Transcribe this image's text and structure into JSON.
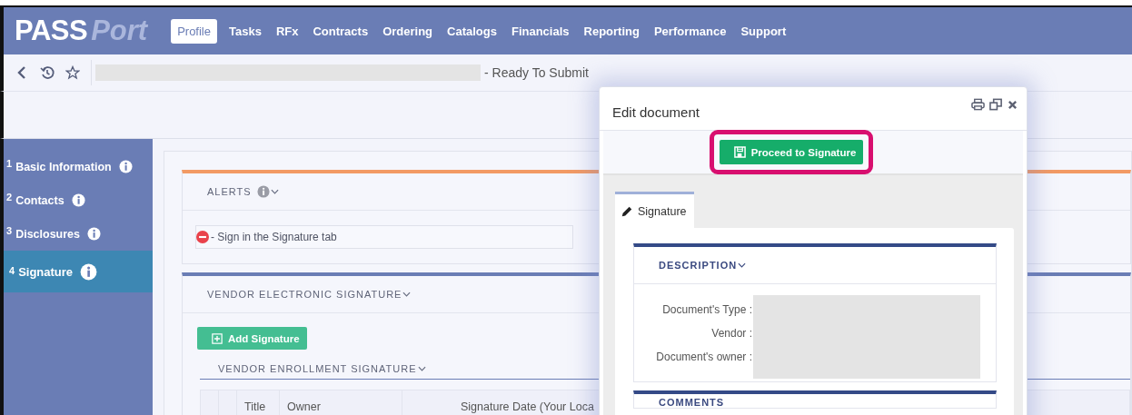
{
  "brand": {
    "bold": "PASS",
    "light": "Port"
  },
  "nav": [
    {
      "label": "Profile",
      "selected": true
    },
    {
      "label": "Tasks",
      "selected": false
    },
    {
      "label": "RFx",
      "selected": false
    },
    {
      "label": "Contracts",
      "selected": false
    },
    {
      "label": "Ordering",
      "selected": false
    },
    {
      "label": "Catalogs",
      "selected": false
    },
    {
      "label": "Financials",
      "selected": false
    },
    {
      "label": "Reporting",
      "selected": false
    },
    {
      "label": "Performance",
      "selected": false
    },
    {
      "label": "Support",
      "selected": false
    }
  ],
  "toolbar": {
    "status": "- Ready To Submit"
  },
  "steps": [
    {
      "number": "1",
      "label": "Basic Information",
      "selected": false
    },
    {
      "number": "2",
      "label": "Contacts",
      "selected": false
    },
    {
      "number": "3",
      "label": "Disclosures",
      "selected": false
    },
    {
      "number": "4",
      "label": "Signature",
      "selected": true
    }
  ],
  "alerts": {
    "title": "ALERTS",
    "items": [
      "- Sign in the Signature tab"
    ]
  },
  "signature_section": {
    "title": "VENDOR ELECTRONIC SIGNATURE",
    "add_button": "Add Signature",
    "subsection": "VENDOR ENROLLMENT SIGNATURE",
    "columns": [
      "Title",
      "Owner",
      "Signature Date (Your Loca"
    ]
  },
  "dialog": {
    "title": "Edit document",
    "primary_button": "Proceed to Signature",
    "primary_highlighted": true,
    "tabs": [
      {
        "label": "Signature",
        "selected": true
      }
    ],
    "description": {
      "title": "DESCRIPTION",
      "fields": [
        "Document's Type :",
        "Vendor :",
        "Document's owner :"
      ]
    },
    "comments": {
      "title": "COMMENTS"
    }
  }
}
